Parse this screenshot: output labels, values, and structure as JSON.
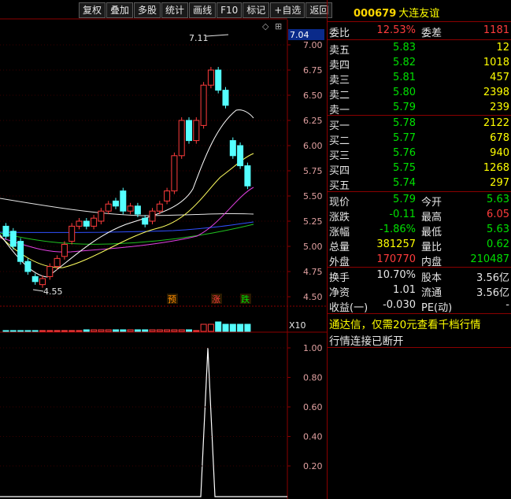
{
  "toolbar": [
    "复权",
    "叠加",
    "多股",
    "统计",
    "画线",
    "F10",
    "标记",
    "+自选",
    "返回"
  ],
  "stock": {
    "code": "000679",
    "name": "大连友谊"
  },
  "order_ratio": {
    "wb_label": "委比",
    "wb_value": "12.53%",
    "wc_label": "委差",
    "wc_value": "1181"
  },
  "asks": [
    {
      "label": "卖五",
      "price": "5.83",
      "vol": "12"
    },
    {
      "label": "卖四",
      "price": "5.82",
      "vol": "1018"
    },
    {
      "label": "卖三",
      "price": "5.81",
      "vol": "457"
    },
    {
      "label": "卖二",
      "price": "5.80",
      "vol": "2398"
    },
    {
      "label": "卖一",
      "price": "5.79",
      "vol": "239"
    }
  ],
  "bids": [
    {
      "label": "买一",
      "price": "5.78",
      "vol": "2122"
    },
    {
      "label": "买二",
      "price": "5.77",
      "vol": "678"
    },
    {
      "label": "买三",
      "price": "5.76",
      "vol": "940"
    },
    {
      "label": "买四",
      "price": "5.75",
      "vol": "1268"
    },
    {
      "label": "买五",
      "price": "5.74",
      "vol": "297"
    }
  ],
  "quote": [
    {
      "l1": "现价",
      "v1": "5.79",
      "c1": "green",
      "l2": "今开",
      "v2": "5.63",
      "c2": "green"
    },
    {
      "l1": "涨跌",
      "v1": "-0.11",
      "c1": "green",
      "l2": "最高",
      "v2": "6.05",
      "c2": "red"
    },
    {
      "l1": "涨幅",
      "v1": "-1.86%",
      "c1": "green",
      "l2": "最低",
      "v2": "5.63",
      "c2": "green"
    },
    {
      "l1": "总量",
      "v1": "381257",
      "c1": "yellow",
      "l2": "量比",
      "v2": "0.62",
      "c2": "green"
    },
    {
      "l1": "外盘",
      "v1": "170770",
      "c1": "red",
      "l2": "内盘",
      "v2": "210487",
      "c2": "green"
    }
  ],
  "fundamentals": [
    {
      "l1": "换手",
      "v1": "10.70%",
      "l2": "股本",
      "v2": "3.56亿"
    },
    {
      "l1": "净资",
      "v1": "1.01",
      "l2": "流通",
      "v2": "3.56亿"
    },
    {
      "l1": "收益(一)",
      "v1": "-0.030",
      "l2": "PE(动)",
      "v2": "-"
    }
  ],
  "messages": {
    "promo": "通达信，仅需20元查看千档行情",
    "status": "行情连接已断开"
  },
  "chart_data": {
    "type": "candlestick",
    "price_axis": [
      "7.00",
      "6.75",
      "6.50",
      "6.25",
      "6.00",
      "5.75",
      "5.50",
      "5.25",
      "5.00",
      "4.75",
      "4.50"
    ],
    "current_price_tag": "7.04",
    "high_label": "7.11",
    "low_label": "4.55",
    "signals": [
      "预",
      "涨",
      "跌"
    ],
    "volume_tag": "X10",
    "indicator_axis": [
      "1.00",
      "0.80",
      "0.60",
      "0.40",
      "0.20"
    ],
    "candles": [
      {
        "o": 5.2,
        "c": 5.1
      },
      {
        "o": 5.15,
        "c": 5.0
      },
      {
        "o": 5.05,
        "c": 4.85
      },
      {
        "o": 4.85,
        "c": 4.75
      },
      {
        "o": 4.7,
        "c": 4.65
      },
      {
        "o": 4.62,
        "c": 4.68
      },
      {
        "o": 4.7,
        "c": 4.8
      },
      {
        "o": 4.8,
        "c": 4.88
      },
      {
        "o": 4.9,
        "c": 5.02
      },
      {
        "o": 5.05,
        "c": 5.2
      },
      {
        "o": 5.2,
        "c": 5.25
      },
      {
        "o": 5.25,
        "c": 5.2
      },
      {
        "o": 5.2,
        "c": 5.28
      },
      {
        "o": 5.25,
        "c": 5.35
      },
      {
        "o": 5.35,
        "c": 5.42
      },
      {
        "o": 5.45,
        "c": 5.4
      },
      {
        "o": 5.55,
        "c": 5.35
      },
      {
        "o": 5.35,
        "c": 5.4
      },
      {
        "o": 5.4,
        "c": 5.32
      },
      {
        "o": 5.28,
        "c": 5.22
      },
      {
        "o": 5.25,
        "c": 5.35
      },
      {
        "o": 5.35,
        "c": 5.42
      },
      {
        "o": 5.45,
        "c": 5.55
      },
      {
        "o": 5.55,
        "c": 5.9
      },
      {
        "o": 5.9,
        "c": 6.25
      },
      {
        "o": 6.25,
        "c": 6.05
      },
      {
        "o": 6.05,
        "c": 6.25
      },
      {
        "o": 6.2,
        "c": 6.6
      },
      {
        "o": 6.6,
        "c": 6.75
      },
      {
        "o": 6.75,
        "c": 6.55
      },
      {
        "o": 6.55,
        "c": 6.4
      },
      {
        "o": 6.05,
        "c": 5.9
      },
      {
        "o": 6.0,
        "c": 5.8
      },
      {
        "o": 5.8,
        "c": 5.6
      }
    ],
    "indicator_values": [
      0,
      0,
      0,
      0,
      0,
      0,
      0,
      0,
      0,
      0,
      0,
      0,
      0,
      0,
      0,
      0,
      0,
      0,
      0,
      0,
      0,
      0,
      0,
      0,
      0,
      0,
      0,
      1,
      0,
      0,
      0,
      0,
      0,
      0
    ]
  }
}
